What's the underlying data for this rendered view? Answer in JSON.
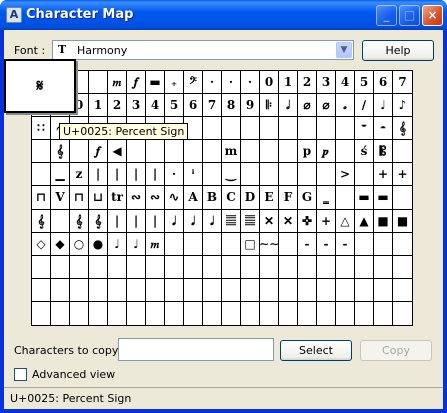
{
  "window": {
    "title": "Character Map"
  },
  "font": {
    "label": "Font :",
    "icon": "truetype-icon",
    "selected": "Harmony"
  },
  "buttons": {
    "help": "Help",
    "select": "Select",
    "copy": "Copy"
  },
  "grid": {
    "cells": [
      "",
      "",
      "",
      "",
      "𝆐",
      "𝆑",
      "▬",
      "₊",
      "𝄢",
      "·",
      "·",
      "·",
      "0",
      "1",
      "2",
      "3",
      "4",
      "5",
      "6",
      "7",
      "8",
      "9",
      "0",
      "1",
      "2",
      "3",
      "4",
      "5",
      "6",
      "7",
      "8",
      "9",
      "𝄆",
      "𝅗𝅥",
      "⌀",
      "⌀",
      "𝅗",
      "∕",
      "♩",
      "♪",
      "∷",
      "𝄐",
      "𝄐",
      "𝆏",
      "",
      "ℌ",
      "𝄌",
      "−",
      "",
      "",
      "",
      "",
      "",
      "",
      "",
      "",
      "",
      "𝄻",
      "𝄼",
      "𝄞",
      "",
      "𝄞",
      "",
      "𝆑",
      "◀",
      "",
      "",
      "",
      "",
      "",
      "m",
      "",
      "",
      "",
      "p",
      "𝆏",
      "",
      "ś",
      "𝄡",
      "",
      "",
      "▁",
      "z",
      "|",
      "|",
      "|",
      "|",
      "·",
      "ⁱ",
      "",
      "‿",
      "",
      "",
      "",
      "",
      "",
      ">",
      "",
      "+",
      "+",
      "⊓",
      "V",
      "⊓",
      "⊔",
      "tr",
      "∾",
      "∾",
      "∿",
      "A",
      "B",
      "C",
      "D",
      "E",
      "F",
      "G",
      "‗",
      "",
      "▬",
      "▬",
      "",
      "𝄞",
      "",
      "𝄞",
      "𝄞",
      "|",
      "|",
      "|",
      "𝅘𝅥",
      "𝅘𝅥",
      "𝅘𝅥",
      "𝄚",
      "𝄚",
      "✕",
      "✕",
      "✜",
      "+",
      "△",
      "▲",
      "■",
      "■",
      "◇",
      "◆",
      "○",
      "●",
      "♩",
      "♩",
      "𝆐",
      "",
      "",
      "",
      "",
      "□",
      "∼∼",
      "",
      "-",
      "-",
      "-",
      "",
      "",
      "",
      "",
      "",
      "",
      "",
      "",
      "",
      "",
      "",
      "",
      "",
      "",
      "",
      "",
      "",
      "",
      "",
      "",
      "",
      "",
      "",
      "",
      "",
      "",
      "",
      "",
      "",
      "",
      "",
      "",
      "",
      "",
      "",
      "",
      "",
      "",
      "",
      "",
      "",
      "",
      "",
      "",
      "",
      "",
      "",
      "",
      "",
      "",
      "",
      "",
      "",
      "",
      "",
      "",
      "",
      "",
      "",
      "",
      "",
      "",
      ""
    ]
  },
  "zoom": {
    "char": "𝄋"
  },
  "tooltip": {
    "text": "U+0025: Percent Sign"
  },
  "copy": {
    "label": "Characters to copy :",
    "value": ""
  },
  "advanced": {
    "label": "Advanced view",
    "checked": false
  },
  "status": {
    "text": "U+0025: Percent Sign"
  }
}
